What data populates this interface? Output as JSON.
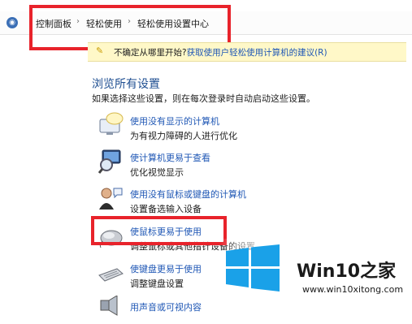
{
  "breadcrumb": {
    "items": [
      "控制面板",
      "轻松使用",
      "轻松使用设置中心"
    ],
    "separator": "›"
  },
  "infobar": {
    "text": "不确定从哪里开始?",
    "link": "获取使用户轻松使用计算机的建议(R)"
  },
  "section": {
    "title": "浏览所有设置",
    "description": "如果选择这些设置，则在每次登录时自动启动这些设置。"
  },
  "items": [
    {
      "link": "使用没有显示的计算机",
      "sub": "为有视力障碍的人进行优化",
      "icon": "monitor-speech-icon"
    },
    {
      "link": "使计算机更易于查看",
      "sub": "优化视觉显示",
      "icon": "magnifier-monitor-icon"
    },
    {
      "link": "使用没有鼠标或键盘的计算机",
      "sub": "设置备选输入设备",
      "icon": "user-speech-icon"
    },
    {
      "link": "使鼠标更易于使用",
      "sub": "调整鼠标或其他指针设备的设置",
      "icon": "mouse-icon"
    },
    {
      "link": "使键盘更易于使用",
      "sub": "调整键盘设置",
      "icon": "keyboard-icon"
    },
    {
      "link": "用声音或可视内容",
      "sub": "",
      "icon": "speaker-icon"
    }
  ],
  "watermark": {
    "brand_prefix": "Win10",
    "brand_suffix": "之家",
    "url": "www.win10xitong.com"
  },
  "colors": {
    "highlight": "#e8232b",
    "link": "#1f57b5",
    "title": "#1e4e91",
    "win_logo": "#1aa1e8"
  }
}
